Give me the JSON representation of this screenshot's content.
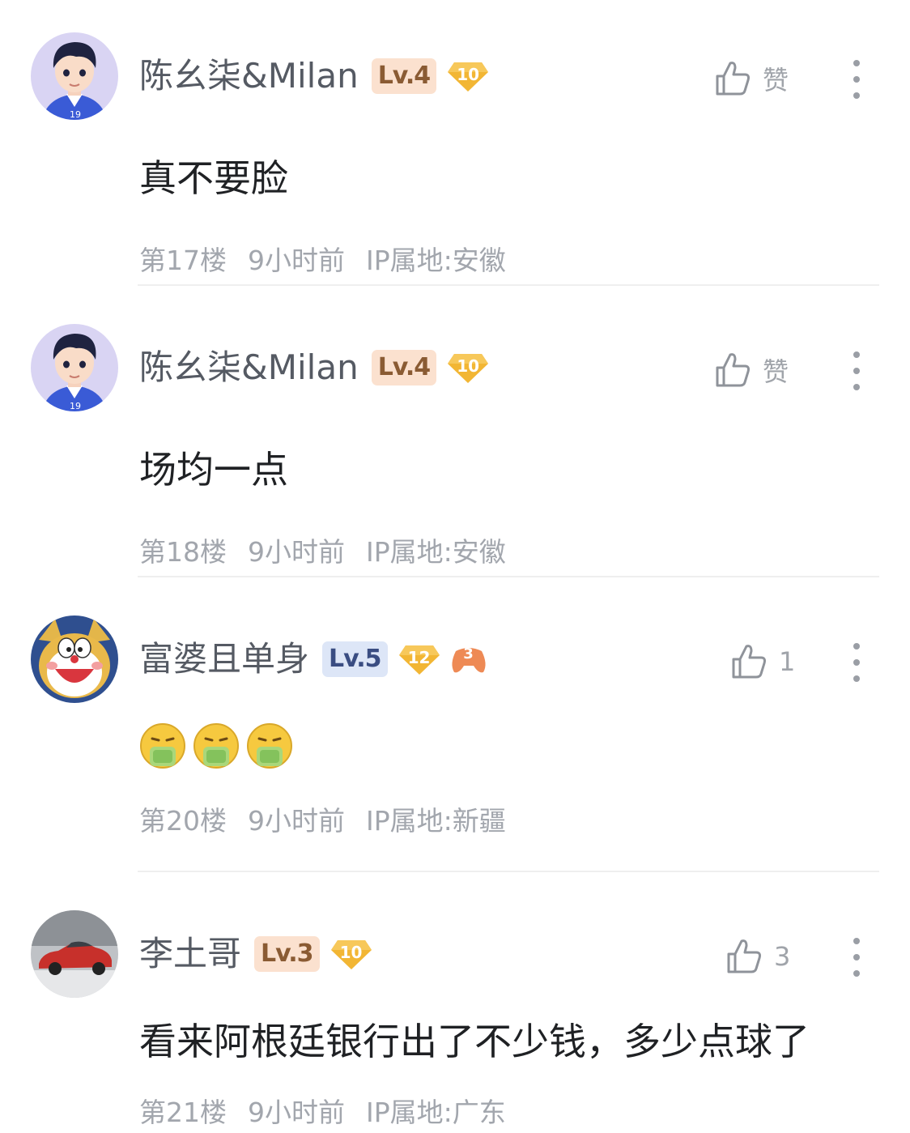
{
  "comments": [
    {
      "username": "陈幺柒&Milan",
      "level": "Lv.4",
      "level_style": "orange",
      "gem": "10",
      "like": "赞",
      "content": "真不要脸",
      "floor": "第17楼",
      "time": "9小时前",
      "ip": "IP属地:安徽"
    },
    {
      "username": "陈幺柒&Milan",
      "level": "Lv.4",
      "level_style": "orange",
      "gem": "10",
      "like": "赞",
      "content": "场均一点",
      "floor": "第18楼",
      "time": "9小时前",
      "ip": "IP属地:安徽"
    },
    {
      "username": "富婆且单身",
      "level": "Lv.5",
      "level_style": "blue",
      "gem": "12",
      "extra_badge": "3",
      "like": "1",
      "content_emojis": [
        "vomit-emoji",
        "vomit-emoji",
        "vomit-emoji"
      ],
      "floor": "第20楼",
      "time": "9小时前",
      "ip": "IP属地:新疆"
    },
    {
      "username": "李土哥",
      "level": "Lv.3",
      "level_style": "orange",
      "gem": "10",
      "like": "3",
      "content": "看来阿根廷银行出了不少钱，多少点球了",
      "floor": "第21楼",
      "time": "9小时前",
      "ip": "IP属地:广东"
    }
  ],
  "colors": {
    "username": "#555a63",
    "content": "#1f2124",
    "meta": "#a2a6ad",
    "gem": "#f2b634",
    "divider": "#efefef"
  }
}
